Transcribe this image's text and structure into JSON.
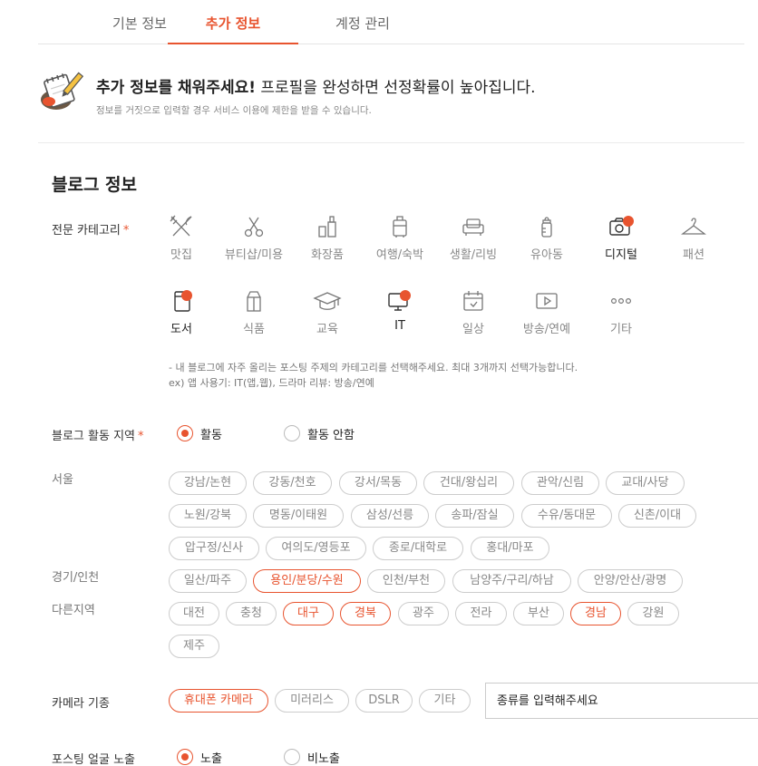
{
  "tabs": [
    {
      "label": "기본 정보",
      "active": false
    },
    {
      "label": "추가 정보",
      "active": true
    },
    {
      "label": "계정 관리",
      "active": false
    }
  ],
  "notice": {
    "title_bold": "추가 정보를 채워주세요!",
    "title_rest": " 프로필을 완성하면 선정확률이 높아집니다.",
    "sub": "정보를 거짓으로 입력할 경우 서비스 이용에 제한을 받을 수 있습니다."
  },
  "section_title": "블로그 정보",
  "category": {
    "label": "전문 카테고리",
    "required_mark": "*",
    "items": [
      {
        "label": "맛집",
        "icon": "fork-knife-icon",
        "selected": false
      },
      {
        "label": "뷰티샵/미용",
        "icon": "scissors-icon",
        "selected": false
      },
      {
        "label": "화장품",
        "icon": "cosmetics-icon",
        "selected": false
      },
      {
        "label": "여행/숙박",
        "icon": "luggage-icon",
        "selected": false
      },
      {
        "label": "생활/리빙",
        "icon": "sofa-icon",
        "selected": false
      },
      {
        "label": "유아동",
        "icon": "baby-bottle-icon",
        "selected": false
      },
      {
        "label": "디지털",
        "icon": "camera-icon",
        "selected": true
      },
      {
        "label": "패션",
        "icon": "hanger-icon",
        "selected": false
      },
      {
        "label": "도서",
        "icon": "book-icon",
        "selected": true
      },
      {
        "label": "식품",
        "icon": "milk-carton-icon",
        "selected": false
      },
      {
        "label": "교육",
        "icon": "graduation-cap-icon",
        "selected": false
      },
      {
        "label": "IT",
        "icon": "computer-icon",
        "selected": true
      },
      {
        "label": "일상",
        "icon": "calendar-icon",
        "selected": false
      },
      {
        "label": "방송/연예",
        "icon": "play-icon",
        "selected": false
      },
      {
        "label": "기타",
        "icon": "more-dots-icon",
        "selected": false
      }
    ],
    "hint_line1": "- 내 블로그에 자주 올리는 포스팅 주제의 카테고리를 선택해주세요. 최대 3개까지 선택가능합니다.",
    "hint_line2": "ex) 앱 사용기: IT(앱,웹), 드라마 리뷰: 방송/연예"
  },
  "activity": {
    "label": "블로그 활동 지역",
    "required_mark": "*",
    "options": [
      {
        "label": "활동",
        "checked": true
      },
      {
        "label": "활동 안함",
        "checked": false
      }
    ]
  },
  "regions": {
    "seoul": {
      "label": "서울",
      "chips": [
        {
          "label": "강남/논현",
          "selected": false
        },
        {
          "label": "강동/천호",
          "selected": false
        },
        {
          "label": "강서/목동",
          "selected": false
        },
        {
          "label": "건대/왕십리",
          "selected": false
        },
        {
          "label": "관악/신림",
          "selected": false
        },
        {
          "label": "교대/사당",
          "selected": false
        },
        {
          "label": "노원/강북",
          "selected": false
        },
        {
          "label": "명동/이태원",
          "selected": false
        },
        {
          "label": "삼성/선릉",
          "selected": false
        },
        {
          "label": "송파/잠실",
          "selected": false
        },
        {
          "label": "수유/동대문",
          "selected": false
        },
        {
          "label": "신촌/이대",
          "selected": false
        },
        {
          "label": "압구정/신사",
          "selected": false
        },
        {
          "label": "여의도/영등포",
          "selected": false
        },
        {
          "label": "종로/대학로",
          "selected": false
        },
        {
          "label": "홍대/마포",
          "selected": false
        }
      ]
    },
    "gyeonggi": {
      "label": "경기/인천",
      "chips": [
        {
          "label": "일산/파주",
          "selected": false
        },
        {
          "label": "용인/분당/수원",
          "selected": true
        },
        {
          "label": "인천/부천",
          "selected": false
        },
        {
          "label": "남양주/구리/하남",
          "selected": false
        },
        {
          "label": "안양/안산/광명",
          "selected": false
        }
      ]
    },
    "other": {
      "label": "다른지역",
      "chips": [
        {
          "label": "대전",
          "selected": false
        },
        {
          "label": "충청",
          "selected": false
        },
        {
          "label": "대구",
          "selected": true
        },
        {
          "label": "경북",
          "selected": true
        },
        {
          "label": "광주",
          "selected": false
        },
        {
          "label": "전라",
          "selected": false
        },
        {
          "label": "부산",
          "selected": false
        },
        {
          "label": "경남",
          "selected": true
        },
        {
          "label": "강원",
          "selected": false
        },
        {
          "label": "제주",
          "selected": false
        }
      ]
    }
  },
  "camera": {
    "label": "카메라 기종",
    "chips": [
      {
        "label": "휴대폰 카메라",
        "selected": true
      },
      {
        "label": "미러리스",
        "selected": false
      },
      {
        "label": "DSLR",
        "selected": false
      },
      {
        "label": "기타",
        "selected": false
      }
    ],
    "input_placeholder": "종류를 입력해주세요"
  },
  "face": {
    "label": "포스팅 얼굴 노출",
    "options": [
      {
        "label": "노출",
        "checked": true
      },
      {
        "label": "비노출",
        "checked": false
      }
    ]
  },
  "colors": {
    "accent": "#e8542f",
    "border": "#cccccc",
    "muted": "#888888"
  }
}
